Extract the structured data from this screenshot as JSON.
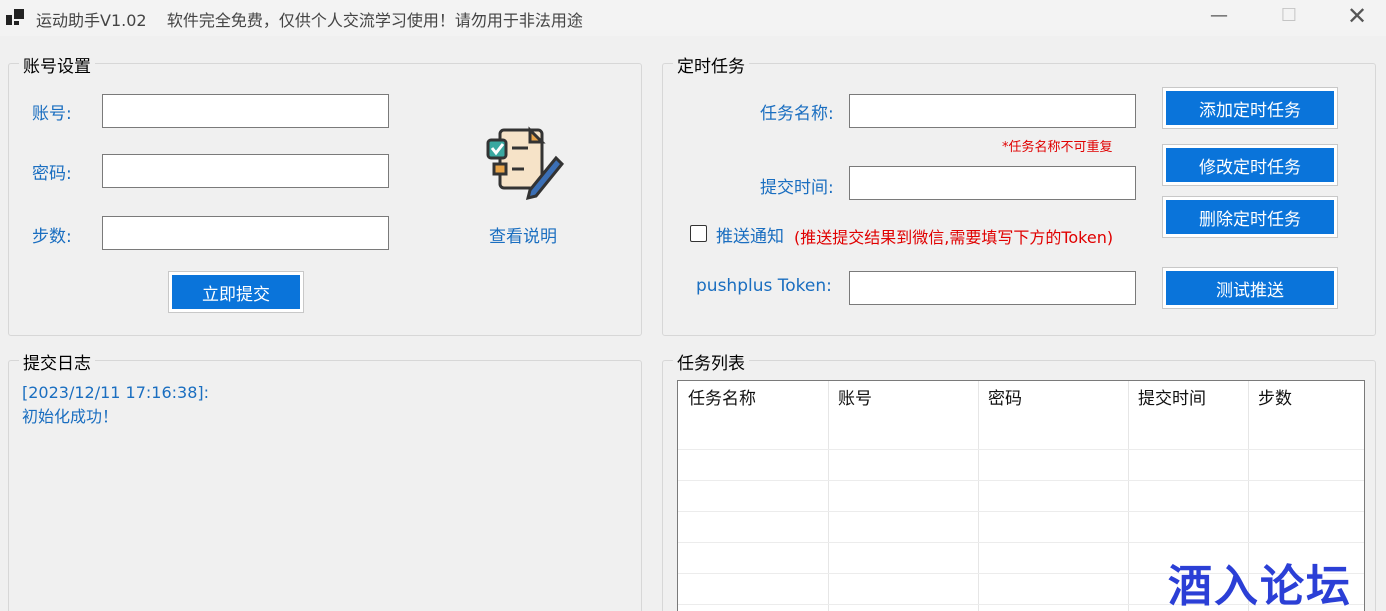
{
  "window": {
    "title": "运动助手V1.02    软件完全免费，仅供个人交流学习使用！请勿用于非法用途",
    "minimize": "—",
    "maximize": "☐",
    "close": "✕"
  },
  "account": {
    "group_title": "账号设置",
    "account_label": "账号:",
    "account_value": "",
    "password_label": "密码:",
    "password_value": "",
    "steps_label": "步数:",
    "steps_value": "",
    "submit_button": "立即提交",
    "help_link": "查看说明",
    "help_icon": "document-edit-icon"
  },
  "schedule": {
    "group_title": "定时任务",
    "task_name_label": "任务名称:",
    "task_name_value": "",
    "task_name_note": "*任务名称不可重复",
    "submit_time_label": "提交时间:",
    "submit_time_value": "",
    "push_checkbox_label": "推送通知",
    "push_checkbox_checked": false,
    "push_hint": "(推送提交结果到微信,需要填写下方的Token)",
    "token_label": "pushplus Token:",
    "token_value": "",
    "add_button": "添加定时任务",
    "edit_button": "修改定时任务",
    "delete_button": "删除定时任务",
    "test_button": "测试推送"
  },
  "log": {
    "group_title": "提交日志",
    "lines": [
      "[2023/12/11 17:16:38]:",
      "初始化成功！"
    ]
  },
  "task_list": {
    "group_title": "任务列表",
    "columns": [
      "任务名称",
      "账号",
      "密码",
      "提交时间",
      "步数"
    ],
    "rows": []
  },
  "watermark": "酒入论坛",
  "colors": {
    "accent": "#0a74da",
    "label_blue": "#1a6ec0",
    "warning_red": "#e00000"
  }
}
